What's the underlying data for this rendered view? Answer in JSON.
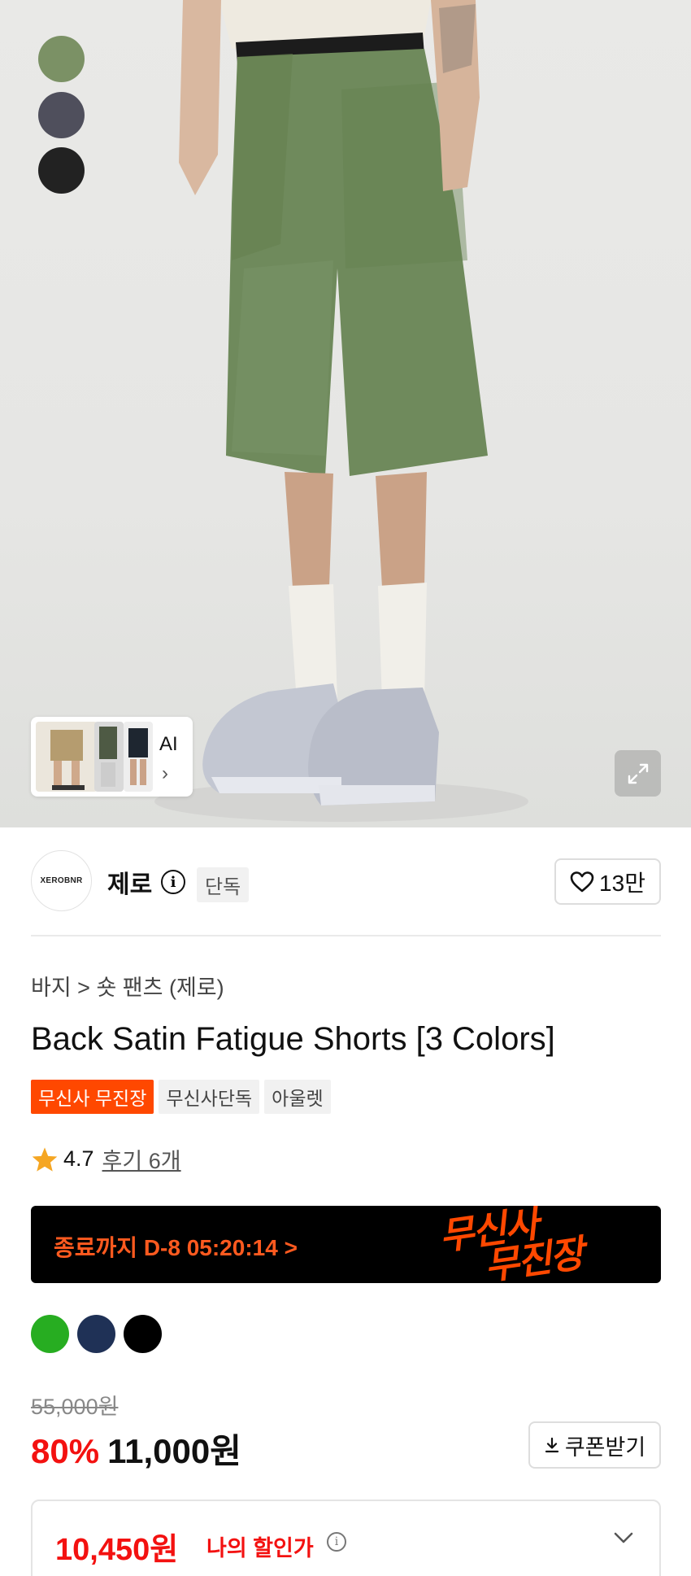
{
  "hero": {
    "color_swatches": [
      {
        "name": "olive",
        "color": "#7b9165"
      },
      {
        "name": "charcoal",
        "color": "#4f4f5c"
      },
      {
        "name": "black",
        "color": "#222222"
      }
    ],
    "ai_card_label": "AI",
    "expand_icon": "expand-icon"
  },
  "brand": {
    "logo_text": "XEROBNR",
    "name": "제로",
    "exclusive_tag": "단독",
    "likes": "13만"
  },
  "product": {
    "breadcrumb": "바지 > 숏 팬츠 (제로)",
    "title": "Back Satin Fatigue Shorts [3 Colors]",
    "tags": [
      "무신사 무진장",
      "무신사단독",
      "아울렛"
    ],
    "rating": "4.7",
    "review_link": "후기 6개"
  },
  "banner": {
    "countdown": "종료까지 D-8 05:20:14 >",
    "logo_line1": "무신사",
    "logo_line2": "무진장"
  },
  "colors": [
    {
      "name": "green",
      "color": "#27ad21"
    },
    {
      "name": "navy",
      "color": "#1f3156"
    },
    {
      "name": "black",
      "color": "#000000"
    }
  ],
  "pricing": {
    "original": "55,000원",
    "discount": "80%",
    "price": "11,000원",
    "coupon_button": "쿠폰받기",
    "my_price_amount": "10,450원",
    "my_price_label": "나의 할인가"
  },
  "accent_color": "#ff4800",
  "sale_color": "#f31110"
}
